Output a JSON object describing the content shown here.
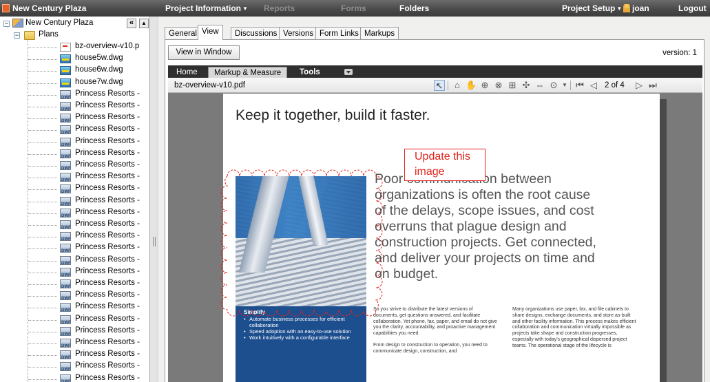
{
  "topbar": {
    "app_title": "New Century Plaza",
    "project_info": "Project Information",
    "reports": "Reports",
    "forms": "Forms",
    "folders": "Folders",
    "project_setup": "Project Setup",
    "user": "joan",
    "logout": "Logout"
  },
  "tree": {
    "root": "New Century Plaza",
    "plans": "Plans",
    "files": [
      {
        "label": "bz-overview-v10.p",
        "icon": "pdf-icon"
      },
      {
        "label": "house5w.dwg",
        "icon": "dwg-icon"
      },
      {
        "label": "house6w.dwg",
        "icon": "dwg-icon"
      },
      {
        "label": "house7w.dwg",
        "icon": "dwg-icon"
      },
      {
        "label": "Princess Resorts -",
        "icon": "dwf-icon"
      },
      {
        "label": "Princess Resorts -",
        "icon": "dwf-icon"
      },
      {
        "label": "Princess Resorts -",
        "icon": "dwf-icon"
      },
      {
        "label": "Princess Resorts -",
        "icon": "dwf-icon"
      },
      {
        "label": "Princess Resorts -",
        "icon": "dwf-icon"
      },
      {
        "label": "Princess Resorts -",
        "icon": "dwf-icon"
      },
      {
        "label": "Princess Resorts -",
        "icon": "dwf-icon"
      },
      {
        "label": "Princess Resorts -",
        "icon": "dwf-icon"
      },
      {
        "label": "Princess Resorts -",
        "icon": "dwf-icon"
      },
      {
        "label": "Princess Resorts -",
        "icon": "dwf-icon"
      },
      {
        "label": "Princess Resorts -",
        "icon": "dwf-icon"
      },
      {
        "label": "Princess Resorts -",
        "icon": "dwf-icon"
      },
      {
        "label": "Princess Resorts -",
        "icon": "dwf-icon"
      },
      {
        "label": "Princess Resorts -",
        "icon": "dwf-icon"
      },
      {
        "label": "Princess Resorts -",
        "icon": "dwf-icon"
      },
      {
        "label": "Princess Resorts -",
        "icon": "dwf-icon"
      },
      {
        "label": "Princess Resorts -",
        "icon": "dwf-icon"
      },
      {
        "label": "Princess Resorts -",
        "icon": "dwf-icon"
      },
      {
        "label": "Princess Resorts -",
        "icon": "dwf-icon"
      },
      {
        "label": "Princess Resorts -",
        "icon": "dwf-icon"
      },
      {
        "label": "Princess Resorts -",
        "icon": "dwf-icon"
      },
      {
        "label": "Princess Resorts -",
        "icon": "dwf-icon"
      },
      {
        "label": "Princess Resorts -",
        "icon": "dwf-icon"
      },
      {
        "label": "Princess Resorts -",
        "icon": "dwf-icon"
      },
      {
        "label": "Princess Resorts -",
        "icon": "dwf-icon"
      }
    ]
  },
  "tabs": [
    "General",
    "View",
    "Discussions",
    "Versions",
    "Form Links",
    "Markups"
  ],
  "active_tab": "View",
  "view": {
    "view_in_window": "View in Window",
    "version": "version: 1"
  },
  "ribbon": {
    "home": "Home",
    "markup": "Markup & Measure",
    "tools": "Tools"
  },
  "viewer": {
    "filename": "bz-overview-v10.pdf",
    "page_indicator": "2 of 4"
  },
  "document": {
    "heading": "Keep it together, build it faster.",
    "big_text_lines": [
      "Poor communication between",
      "organizations is often the root cause",
      "of the delays, scope issues, and cost",
      "overruns that plague design and",
      "construction projects. Get connected,",
      "and deliver your projects on time and",
      "on budget."
    ],
    "simplify_title": "Simplify",
    "simplify_items": [
      "Automate business processes for efficient collaboration",
      "Speed adoption with an easy-to-use solution",
      "Work intuitively with a configurable interface"
    ],
    "col1_p1": "So you strive to distribute the latest versions of documents, get questions answered, and facilitate collaboration. Yet phone, fax, paper, and email do not give you the clarity, accountability, and proactive management capabilities you need.",
    "col1_p2": "From design to construction to operation, you need to communicate design, construction, and",
    "col2_p1": "Many organizations use paper, fax, and file cabinets to share designs, exchange documents, and store as-built and other facility information. This process makes efficient collaboration and communication virtually impossible as projects take shape and construction progresses, especially with today's geographical dispersed project teams. The operational stage of the lifecycle is",
    "callout": "Update this image"
  },
  "colors": {
    "topbar": "#4a4a4a",
    "markup_red": "#e2231a",
    "doc_blue": "#1d4f8f"
  }
}
